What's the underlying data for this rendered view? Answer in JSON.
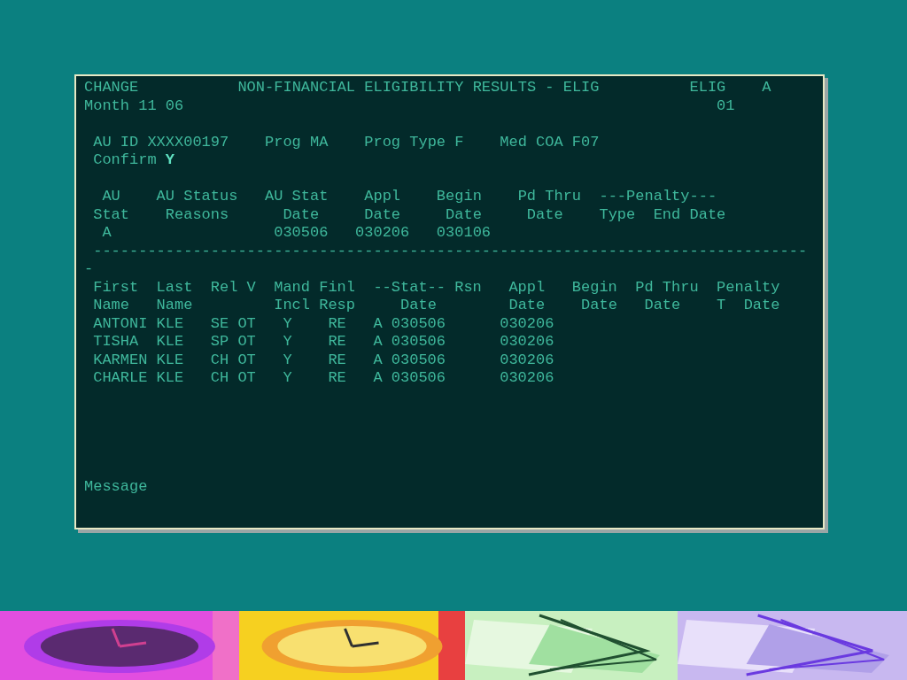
{
  "terminal": {
    "header": {
      "mode": "CHANGE",
      "title": "NON-FINANCIAL ELIGIBILITY RESULTS - ELIG",
      "screen_code": "ELIG",
      "flag": "A",
      "month": "Month 11 06",
      "page": "01"
    },
    "au_info": {
      "fields": [
        "AU ID XXXX00197",
        "Prog MA",
        "Prog Type F",
        "Med COA F07"
      ],
      "confirm_label": "Confirm",
      "confirm_value": "Y"
    },
    "au_table": {
      "columns": [
        {
          "top": "AU",
          "bottom": "Stat"
        },
        {
          "top": "AU Status",
          "bottom": "Reasons"
        },
        {
          "top": "AU Stat",
          "bottom": "Date"
        },
        {
          "top": "Appl",
          "bottom": "Date"
        },
        {
          "top": "Begin",
          "bottom": "Date"
        },
        {
          "top": "Pd Thru",
          "bottom": "Date"
        },
        {
          "top": "---Penalty---",
          "bottom": "Type"
        },
        {
          "bottom": "End Date"
        }
      ],
      "row": {
        "au_stat": "A",
        "au_stat_date": "030506",
        "appl_date": "030206",
        "begin_date": "030106"
      }
    },
    "separator": "--------------------------------------------------------------------------------",
    "member_table": {
      "columns": [
        {
          "top": "First",
          "bottom": "Name"
        },
        {
          "top": "Last",
          "bottom": "Name"
        },
        {
          "top": "Rel"
        },
        {
          "top": "V"
        },
        {
          "top": "Mand",
          "bottom": "Incl"
        },
        {
          "top": "Finl",
          "bottom": "Resp"
        },
        {
          "top": "--Stat--",
          "bottom": "Date"
        },
        {
          "top": "Rsn"
        },
        {
          "top": "Appl",
          "bottom": "Date"
        },
        {
          "top": "Begin",
          "bottom": "Date"
        },
        {
          "top": "Pd Thru",
          "bottom": "Date"
        },
        {
          "top": "Penalty",
          "bottom": "T"
        },
        {
          "bottom": "Date"
        }
      ],
      "rows": [
        {
          "first": "ANTONI",
          "last": "KLE",
          "rel": "SE",
          "v": "OT",
          "mand": "Y",
          "finl": "RE",
          "stat": "A",
          "stat_date": "030506",
          "appl_date": "030206"
        },
        {
          "first": "TISHA",
          "last": "KLE",
          "rel": "SP",
          "v": "OT",
          "mand": "Y",
          "finl": "RE",
          "stat": "A",
          "stat_date": "030506",
          "appl_date": "030206"
        },
        {
          "first": "KARMEN",
          "last": "KLE",
          "rel": "CH",
          "v": "OT",
          "mand": "Y",
          "finl": "RE",
          "stat": "A",
          "stat_date": "030506",
          "appl_date": "030206"
        },
        {
          "first": "CHARLE",
          "last": "KLE",
          "rel": "CH",
          "v": "OT",
          "mand": "Y",
          "finl": "RE",
          "stat": "A",
          "stat_date": "030506",
          "appl_date": "030206"
        }
      ]
    },
    "message_label": "Message"
  }
}
